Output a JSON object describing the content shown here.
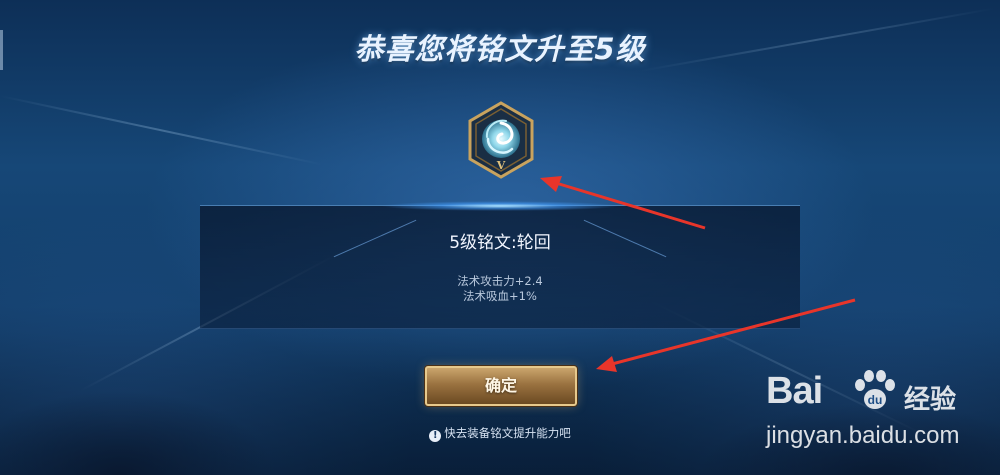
{
  "title": "恭喜您将铭文升至5级",
  "emblem": {
    "icon": "rune-emblem-icon",
    "level_mark": "V"
  },
  "rune": {
    "name": "5级铭文:轮回",
    "stats": [
      "法术攻击力+2.4",
      "法术吸血+1%"
    ]
  },
  "confirm_button": {
    "label": "确定"
  },
  "tip": {
    "icon": "info-icon",
    "text": "快去装备铭文提升能力吧"
  },
  "watermark": {
    "logo": "Bai",
    "logo_du": "du",
    "cn": "经验",
    "url": "jingyan.baidu.com"
  },
  "colors": {
    "accent": "#caa56c",
    "background": "#164777",
    "annotation": "#e8352a"
  }
}
